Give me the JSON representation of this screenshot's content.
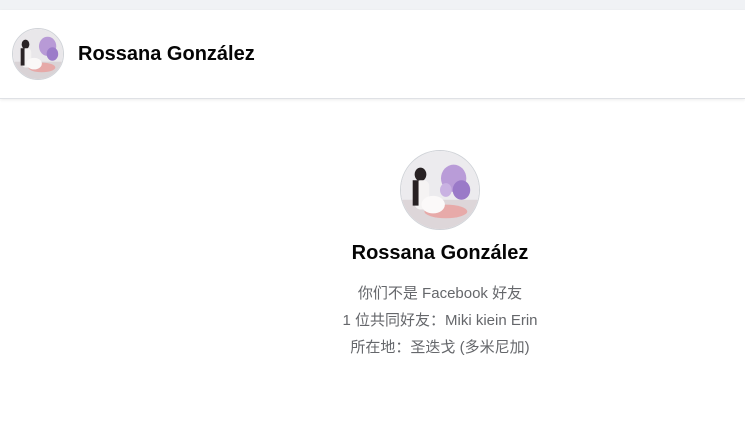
{
  "header": {
    "name": "Rossana González"
  },
  "profile": {
    "name": "Rossana González",
    "friend_status": "你们不是 Facebook 好友",
    "mutual_friends": "1 位共同好友：Miki kiein Erin",
    "location": "所在地：圣迭戈 (多米尼加)"
  },
  "colors": {
    "header_bg": "#ffffff",
    "page_bg": "#ffffff",
    "top_strip": "#f0f2f5",
    "name_text": "#050505",
    "secondary_text": "#65676b"
  }
}
